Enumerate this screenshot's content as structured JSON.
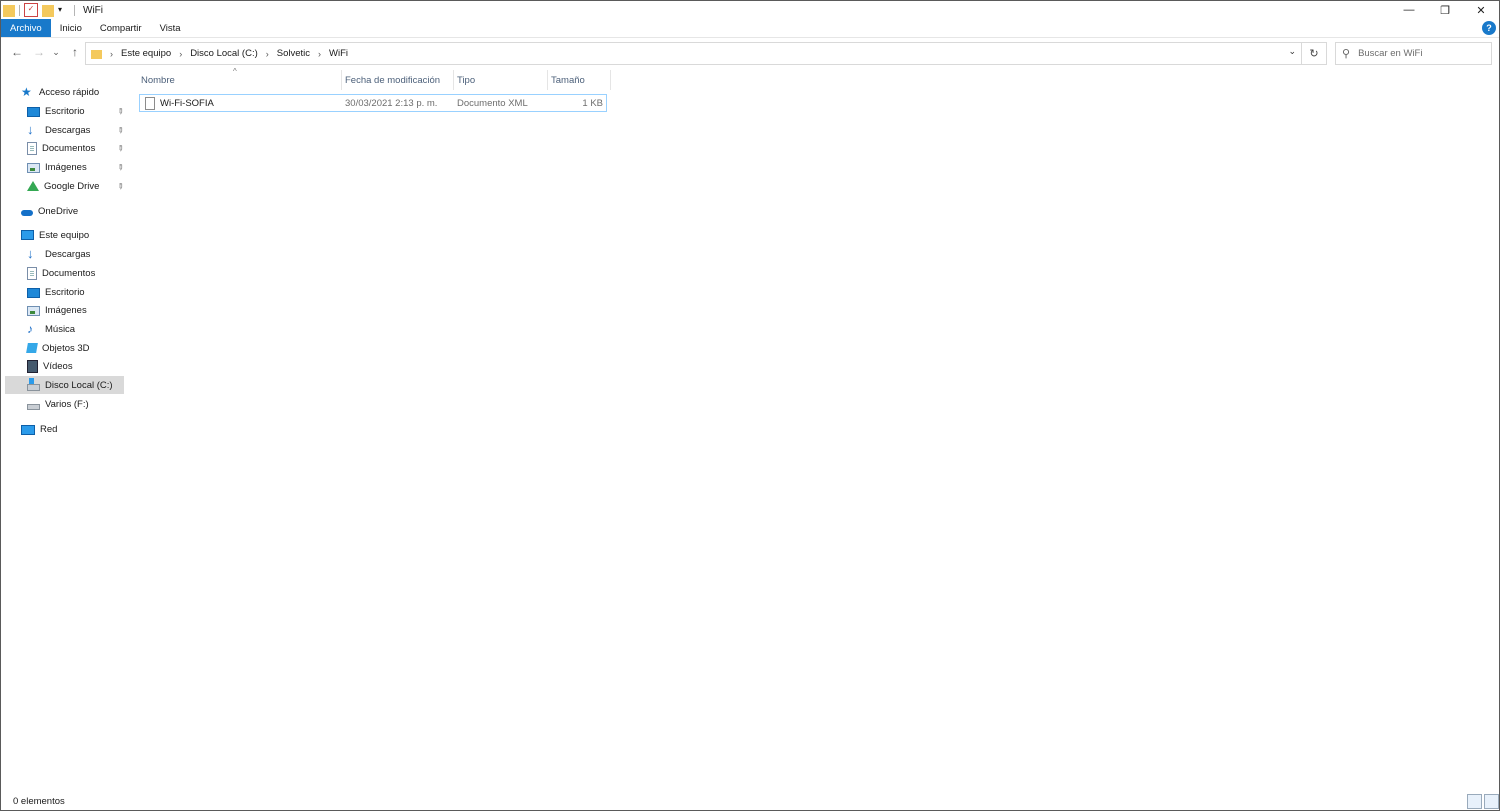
{
  "window": {
    "title": "WiFi",
    "controls": {
      "minimize": "—",
      "restore": "❐",
      "close": "✕"
    }
  },
  "ribbon": {
    "tabs": [
      {
        "label": "Archivo",
        "active": true
      },
      {
        "label": "Inicio"
      },
      {
        "label": "Compartir"
      },
      {
        "label": "Vista"
      }
    ],
    "help_label": "?"
  },
  "navigation": {
    "back": "←",
    "forward": "→",
    "recent": "⌄",
    "up": "↑"
  },
  "address": {
    "crumbs": [
      "Este equipo",
      "Disco Local (C:)",
      "Solvetic",
      "WiFi"
    ],
    "separator": "›",
    "dropdown": "⌄",
    "refresh": "↻"
  },
  "search": {
    "icon": "⚲",
    "placeholder": "Buscar en WiFi"
  },
  "sidebar": {
    "items": [
      {
        "label": "Acceso rápido",
        "icon": "star-icon",
        "level": 0
      },
      {
        "label": "Escritorio",
        "icon": "desktop-icon",
        "level": 1,
        "pinned": true
      },
      {
        "label": "Descargas",
        "icon": "download-icon",
        "level": 1,
        "pinned": true
      },
      {
        "label": "Documentos",
        "icon": "documents-icon",
        "level": 1,
        "pinned": true
      },
      {
        "label": "Imágenes",
        "icon": "pictures-icon",
        "level": 1,
        "pinned": true
      },
      {
        "label": "Google Drive",
        "icon": "google-drive-icon",
        "level": 1,
        "pinned": true
      },
      {
        "label": "OneDrive",
        "icon": "onedrive-icon",
        "level": 0
      },
      {
        "label": "Este equipo",
        "icon": "this-pc-icon",
        "level": 0
      },
      {
        "label": "Descargas",
        "icon": "download-icon",
        "level": 1
      },
      {
        "label": "Documentos",
        "icon": "documents-icon",
        "level": 1
      },
      {
        "label": "Escritorio",
        "icon": "desktop-icon",
        "level": 1
      },
      {
        "label": "Imágenes",
        "icon": "pictures-icon",
        "level": 1
      },
      {
        "label": "Música",
        "icon": "music-icon",
        "level": 1
      },
      {
        "label": "Objetos 3D",
        "icon": "3d-objects-icon",
        "level": 1
      },
      {
        "label": "Vídeos",
        "icon": "videos-icon",
        "level": 1
      },
      {
        "label": "Disco Local (C:)",
        "icon": "local-disk-icon",
        "level": 1,
        "selected": true
      },
      {
        "label": "Varios (F:)",
        "icon": "drive-icon",
        "level": 1
      },
      {
        "label": "Red",
        "icon": "network-icon",
        "level": 0
      }
    ],
    "pin_glyph": "📌"
  },
  "filelist": {
    "columns": [
      "Nombre",
      "Fecha de modificación",
      "Tipo",
      "Tamaño"
    ],
    "sort_indicator": "^",
    "rows": [
      {
        "name": "Wi-Fi-SOFIA",
        "modified": "30/03/2021 2:13 p. m.",
        "type": "Documento XML",
        "size": "1 KB"
      }
    ]
  },
  "status": {
    "text": "0 elementos"
  },
  "colors": {
    "accent": "#1979ca",
    "selection_border": "#99d1ff",
    "column_header_text": "#4c607a"
  }
}
